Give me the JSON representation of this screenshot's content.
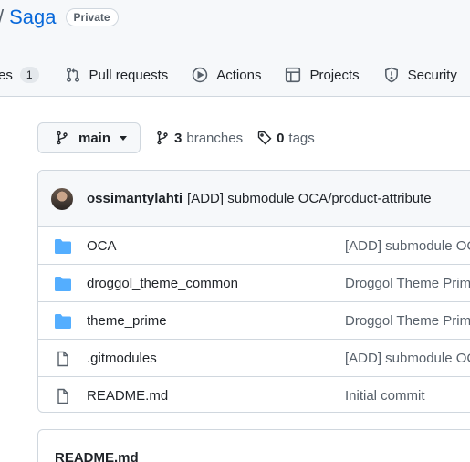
{
  "repo": {
    "separator": "/",
    "name": "Saga",
    "visibility": "Private"
  },
  "tabs": [
    {
      "label": "es",
      "count": "1"
    },
    {
      "label": "Pull requests"
    },
    {
      "label": "Actions"
    },
    {
      "label": "Projects"
    },
    {
      "label": "Security"
    }
  ],
  "branch": {
    "current": "main",
    "branches_count": "3",
    "branches_label": "branches",
    "tags_count": "0",
    "tags_label": "tags"
  },
  "latest_commit": {
    "author": "ossimantylahti",
    "message": "[ADD] submodule OCA/product-attribute"
  },
  "files": [
    {
      "type": "folder",
      "name": "OCA",
      "commit": "[ADD] submodule OCA/product-attribute"
    },
    {
      "type": "folder",
      "name": "droggol_theme_common",
      "commit": "Droggol Theme Prime"
    },
    {
      "type": "folder",
      "name": "theme_prime",
      "commit": "Droggol Theme Prime"
    },
    {
      "type": "file",
      "name": ".gitmodules",
      "commit": "[ADD] submodule OCA/product-attribute"
    },
    {
      "type": "file",
      "name": "README.md",
      "commit": "Initial commit"
    }
  ],
  "readme": {
    "title": "README.md"
  },
  "colors": {
    "accent": "#0969da",
    "folder": "#54aeff",
    "muted": "#57606a",
    "border": "#d0d7de"
  }
}
